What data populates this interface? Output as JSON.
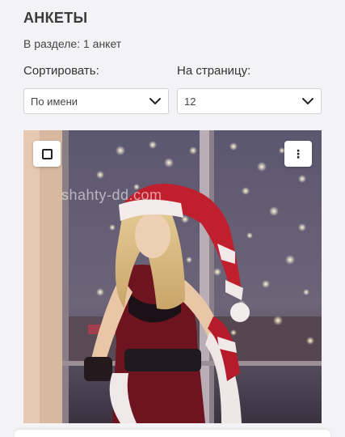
{
  "header": {
    "title": "АНКЕТЫ",
    "count_text": "В разделе: 1 анкет"
  },
  "controls": {
    "sort_label": "Сортировать:",
    "sort_value": "По имени",
    "per_page_label": "На страницу:",
    "per_page_value": "12"
  },
  "profile_card": {
    "watermark": "shahty-dd.com",
    "menu_glyph": "⋮",
    "checkbox_icon": "checkbox-icon",
    "menu_icon": "more-vertical-icon"
  }
}
